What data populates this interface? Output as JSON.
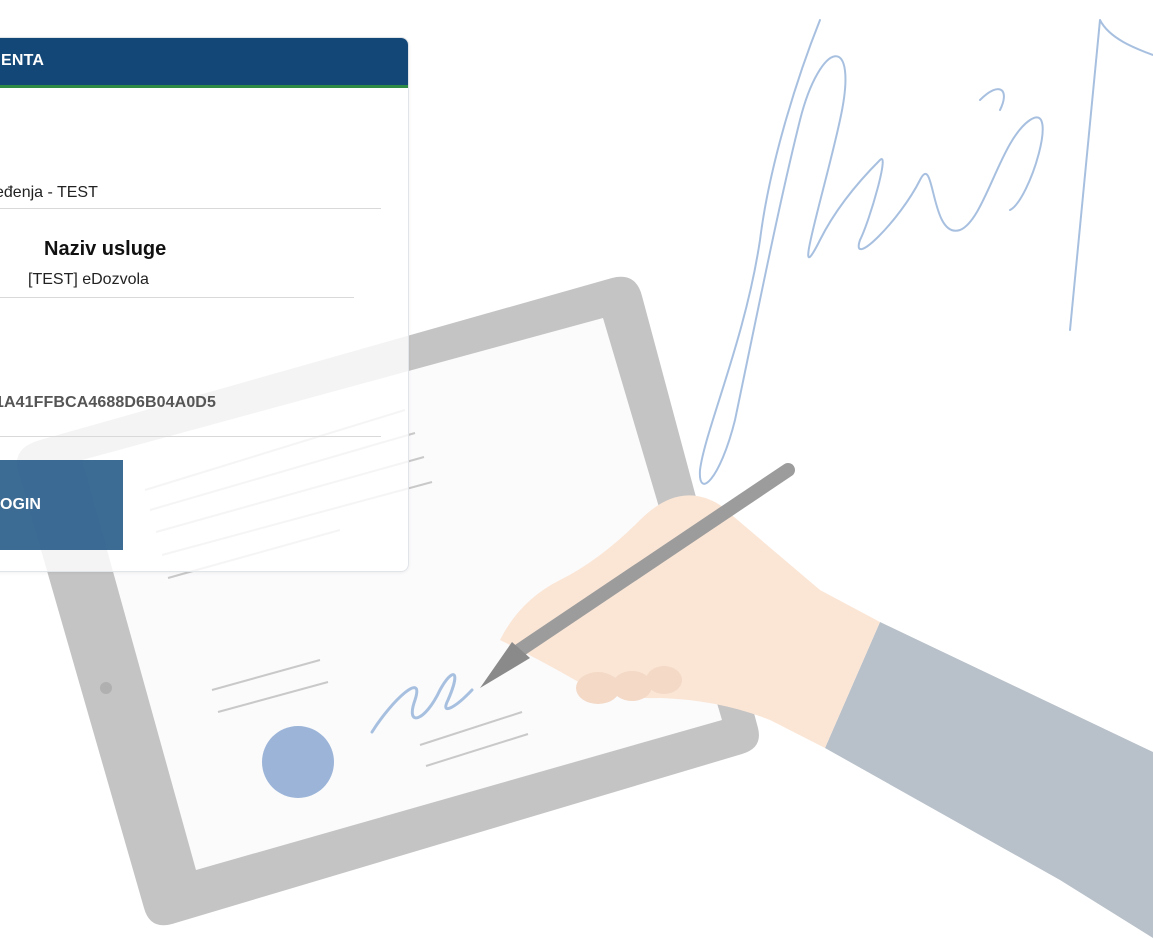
{
  "card": {
    "title": "ENTA",
    "institution_value": "eđenja - TEST",
    "service_title": "Naziv usluge",
    "service_value": "[TEST] eDozvola",
    "token_value": "1A41FFBCA4688D6B04A0D5",
    "login_label": "OGIN"
  },
  "colors": {
    "header": "#134777",
    "header_accent": "#2e8a44",
    "button": "#2c5f8c",
    "tablet_frame": "#bebebe",
    "hand": "#fae4d4",
    "sleeve": "#b8c0c9",
    "signature": "#a8c0e0",
    "seal": "#9bb4d8"
  },
  "illustration": {
    "icons": [
      "tablet-icon",
      "pen-icon",
      "hand-icon",
      "signature-icon",
      "seal-icon"
    ]
  }
}
